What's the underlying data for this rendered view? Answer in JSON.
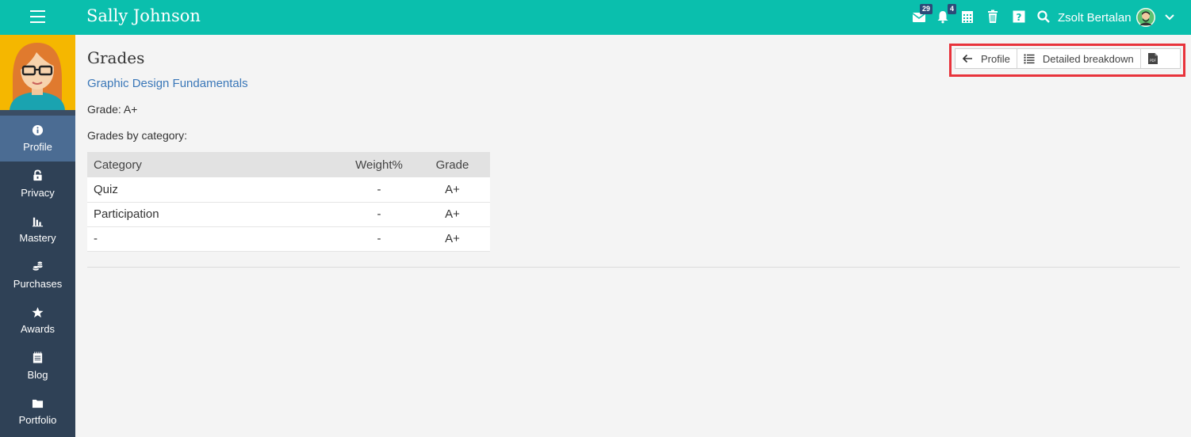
{
  "topbar": {
    "title": "Sally Johnson",
    "messages_badge": "29",
    "notifications_badge": "4",
    "user_name": "Zsolt Bertalan",
    "icons": [
      "menu-icon",
      "mail-icon",
      "bell-icon",
      "calendar-icon",
      "trash-icon",
      "help-icon",
      "search-icon",
      "chevron-down-icon"
    ]
  },
  "sidebar": {
    "items": [
      {
        "label": "Profile",
        "icon": "info-icon",
        "active": true
      },
      {
        "label": "Privacy",
        "icon": "lock-icon"
      },
      {
        "label": "Mastery",
        "icon": "bar-chart-icon"
      },
      {
        "label": "Purchases",
        "icon": "coins-icon"
      },
      {
        "label": "Awards",
        "icon": "star-icon"
      },
      {
        "label": "Blog",
        "icon": "notepad-icon"
      },
      {
        "label": "Portfolio",
        "icon": "folder-icon"
      }
    ]
  },
  "main": {
    "title": "Grades",
    "course": "Graphic Design Fundamentals",
    "grade": "Grade: A+",
    "category_heading": "Grades by category:",
    "table": {
      "headers": [
        "Category",
        "Weight%",
        "Grade"
      ],
      "rows": [
        [
          "Quiz",
          "-",
          "A+"
        ],
        [
          "Participation",
          "-",
          "A+"
        ],
        [
          "-",
          "-",
          "A+"
        ]
      ]
    }
  },
  "actions": {
    "back_label": "Profile",
    "breakdown_label": "Detailed breakdown",
    "pdf_icon": "pdf-icon"
  },
  "colors": {
    "topbar": "#0abfad",
    "sidebar": "#2f4156",
    "sidebar_active": "#4b6c93",
    "link": "#3a77b8",
    "highlight": "#e8333b",
    "badge": "#2c4a78"
  }
}
